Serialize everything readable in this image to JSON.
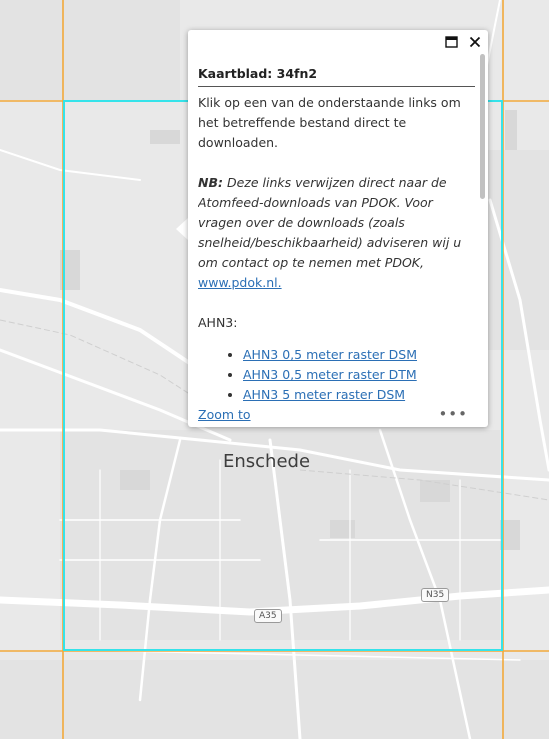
{
  "map": {
    "city_label": "Enschede",
    "road_labels": {
      "a35": "A35",
      "n35": "N35"
    },
    "colors": {
      "grid_line": "#f2a93b",
      "selected_tile": "#35e3ea",
      "background": "#e9e9e9"
    }
  },
  "popup": {
    "title": "Kaartblad: 34fn2",
    "intro": "Klik op een van de onderstaande links om het betreffende bestand direct te downloaden.",
    "note_label": "NB:",
    "note_text": " Deze links verwijzen direct naar de Atomfeed-downloads van PDOK. Voor vragen over de downloads (zoals snelheid/beschikbaarheid) adviseren wij u om contact op te nemen met PDOK, ",
    "note_link": "www.pdok.nl.",
    "section": "AHN3:",
    "links": [
      "AHN3 0,5 meter raster DSM",
      "AHN3 0,5 meter raster DTM",
      "AHN3 5 meter raster DSM"
    ],
    "zoom_to": "Zoom to",
    "icons": {
      "maximize": "maximize-icon",
      "close": "close-icon",
      "more": "more-icon"
    }
  }
}
